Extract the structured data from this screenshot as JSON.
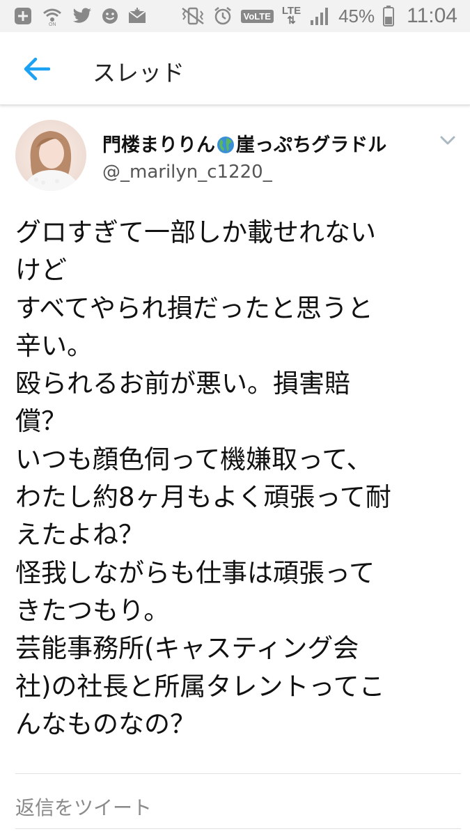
{
  "status_bar": {
    "left_icons": [
      "plus-box-icon",
      "wifi-off-icon",
      "twitter-bird-icon",
      "smiley-icon",
      "mail-icon"
    ],
    "right_icons": [
      "vibrate-icon",
      "alarm-icon",
      "volte-badge-icon",
      "lte-icon",
      "signal-icon",
      "battery-icon"
    ],
    "volte_label": "VoLTE",
    "lte_label": "LTE",
    "battery_percent": "45%",
    "time": "11:04"
  },
  "app_bar": {
    "title": "スレッド",
    "accent_color": "#1da1f2"
  },
  "tweet": {
    "author_name_part1": "門楼まりりん",
    "author_name_part2": "崖っぷちグラドル",
    "handle": "@_marilyn_c1220_",
    "body_lines": [
      "グロすぎて一部しか載せれない",
      "けど",
      "すべてやられ損だったと思うと",
      "辛い。",
      "殴られるお前が悪い。損害賠",
      "償？",
      "いつも顔色伺って機嫌取って、",
      "わたし約8ヶ月もよく頑張って耐",
      "えたよね？",
      "怪我しながらも仕事は頑張って",
      "きたつもり。",
      "芸能事務所(キャスティング会",
      "社)の社長と所属タレントってこ",
      "んなものなの？"
    ]
  },
  "reply": {
    "label": "返信をツイート"
  }
}
